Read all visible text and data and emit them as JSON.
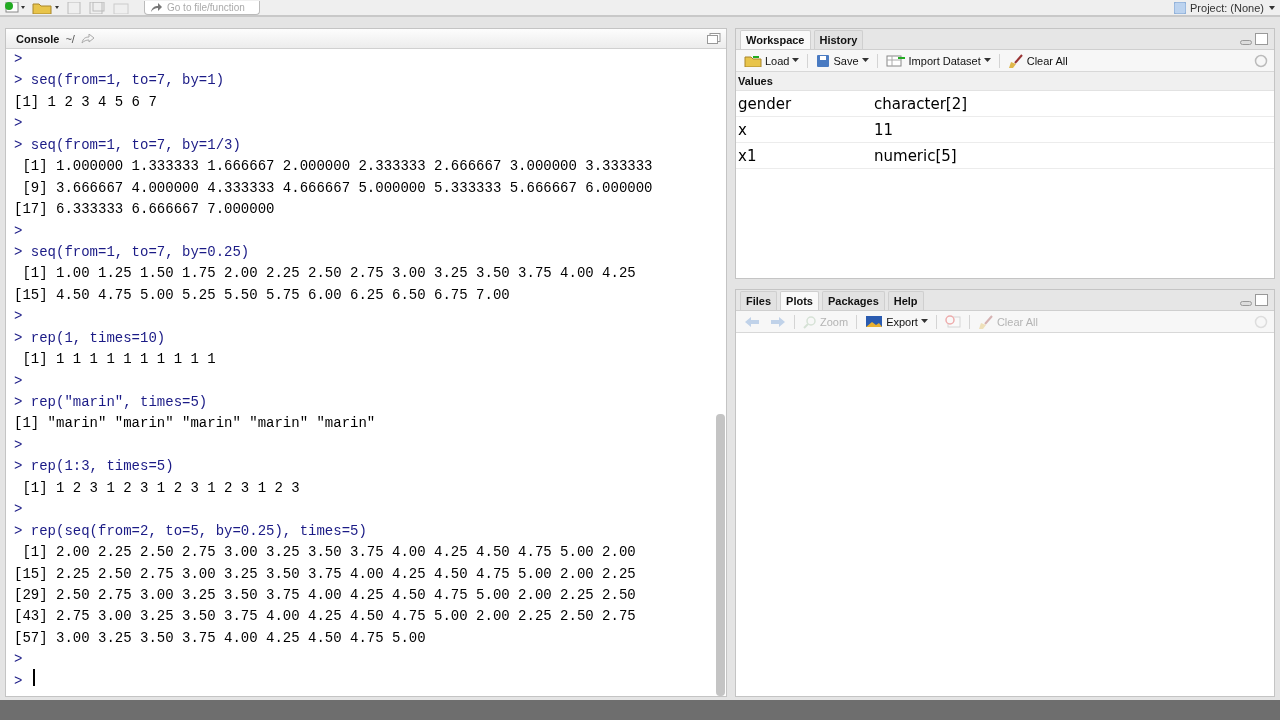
{
  "toolbar": {
    "goto_placeholder": "Go to file/function",
    "project": "Project: (None)"
  },
  "console": {
    "title": "Console",
    "path": "~/",
    "lines": [
      {
        "kind": "input",
        "text": ">"
      },
      {
        "kind": "input",
        "text": "> seq(from=1, to=7, by=1)"
      },
      {
        "kind": "output",
        "text": "[1] 1 2 3 4 5 6 7"
      },
      {
        "kind": "input",
        "text": ">"
      },
      {
        "kind": "input",
        "text": "> seq(from=1, to=7, by=1/3)"
      },
      {
        "kind": "output",
        "text": " [1] 1.000000 1.333333 1.666667 2.000000 2.333333 2.666667 3.000000 3.333333"
      },
      {
        "kind": "output",
        "text": " [9] 3.666667 4.000000 4.333333 4.666667 5.000000 5.333333 5.666667 6.000000"
      },
      {
        "kind": "output",
        "text": "[17] 6.333333 6.666667 7.000000"
      },
      {
        "kind": "input",
        "text": ">"
      },
      {
        "kind": "input",
        "text": "> seq(from=1, to=7, by=0.25)"
      },
      {
        "kind": "output",
        "text": " [1] 1.00 1.25 1.50 1.75 2.00 2.25 2.50 2.75 3.00 3.25 3.50 3.75 4.00 4.25"
      },
      {
        "kind": "output",
        "text": "[15] 4.50 4.75 5.00 5.25 5.50 5.75 6.00 6.25 6.50 6.75 7.00"
      },
      {
        "kind": "input",
        "text": ">"
      },
      {
        "kind": "input",
        "text": "> rep(1, times=10)"
      },
      {
        "kind": "output",
        "text": " [1] 1 1 1 1 1 1 1 1 1 1"
      },
      {
        "kind": "input",
        "text": ">"
      },
      {
        "kind": "input",
        "text": "> rep(\"marin\", times=5)"
      },
      {
        "kind": "output",
        "text": "[1] \"marin\" \"marin\" \"marin\" \"marin\" \"marin\""
      },
      {
        "kind": "input",
        "text": ">"
      },
      {
        "kind": "input",
        "text": "> rep(1:3, times=5)"
      },
      {
        "kind": "output",
        "text": " [1] 1 2 3 1 2 3 1 2 3 1 2 3 1 2 3"
      },
      {
        "kind": "input",
        "text": ">"
      },
      {
        "kind": "input",
        "text": "> rep(seq(from=2, to=5, by=0.25), times=5)"
      },
      {
        "kind": "output",
        "text": " [1] 2.00 2.25 2.50 2.75 3.00 3.25 3.50 3.75 4.00 4.25 4.50 4.75 5.00 2.00"
      },
      {
        "kind": "output",
        "text": "[15] 2.25 2.50 2.75 3.00 3.25 3.50 3.75 4.00 4.25 4.50 4.75 5.00 2.00 2.25"
      },
      {
        "kind": "output",
        "text": "[29] 2.50 2.75 3.00 3.25 3.50 3.75 4.00 4.25 4.50 4.75 5.00 2.00 2.25 2.50"
      },
      {
        "kind": "output",
        "text": "[43] 2.75 3.00 3.25 3.50 3.75 4.00 4.25 4.50 4.75 5.00 2.00 2.25 2.50 2.75"
      },
      {
        "kind": "output",
        "text": "[57] 3.00 3.25 3.50 3.75 4.00 4.25 4.50 4.75 5.00"
      },
      {
        "kind": "input",
        "text": ">"
      },
      {
        "kind": "input",
        "text": ">"
      }
    ]
  },
  "workspace": {
    "tabs": [
      {
        "label": "Workspace",
        "selected": true
      },
      {
        "label": "History",
        "selected": false
      }
    ],
    "tools": [
      {
        "kind": "load",
        "label": "Load",
        "menu": true
      },
      {
        "kind": "save",
        "label": "Save",
        "menu": true
      },
      {
        "kind": "import",
        "label": "Import Dataset",
        "menu": true
      },
      {
        "kind": "clear",
        "label": "Clear All",
        "menu": false
      }
    ],
    "section": "Values",
    "rows": [
      {
        "name": "gender",
        "value": "character[2]"
      },
      {
        "name": "x",
        "value": "11"
      },
      {
        "name": "x1",
        "value": "numeric[5]"
      }
    ]
  },
  "files": {
    "tabs": [
      {
        "label": "Files",
        "selected": false
      },
      {
        "label": "Plots",
        "selected": true
      },
      {
        "label": "Packages",
        "selected": false
      },
      {
        "label": "Help",
        "selected": false
      }
    ],
    "tools": [
      {
        "kind": "back",
        "disabled": true
      },
      {
        "kind": "forward",
        "disabled": true
      },
      {
        "kind": "zoom",
        "label": "Zoom",
        "disabled": true
      },
      {
        "kind": "export",
        "label": "Export",
        "disabled": false
      },
      {
        "kind": "remove",
        "disabled": true
      },
      {
        "kind": "clear",
        "label": "Clear All",
        "disabled": true
      }
    ]
  }
}
